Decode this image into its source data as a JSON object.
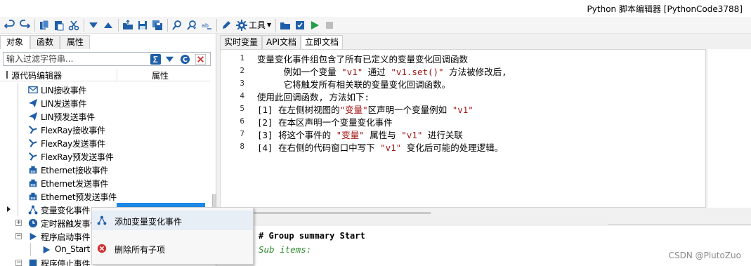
{
  "window": {
    "title": "Python 脚本编辑器 [PythonCode3788]"
  },
  "toolbar": {
    "tools_label": "工具"
  },
  "left_panel": {
    "tabs": [
      "对象",
      "函数",
      "属性"
    ],
    "filter_placeholder": "输入过滤字符串...",
    "tree_header": {
      "col1": "源代码编辑器",
      "col2": "属性"
    },
    "tree_items": [
      {
        "label": "LIN接收事件",
        "icon": "envelope-icon"
      },
      {
        "label": "LIN发送事件",
        "icon": "send-icon"
      },
      {
        "label": "LIN预发送事件",
        "icon": "send-icon"
      },
      {
        "label": "FlexRay接收事件",
        "icon": "flexray-icon"
      },
      {
        "label": "FlexRay发送事件",
        "icon": "flexray-icon"
      },
      {
        "label": "FlexRay预发送事件",
        "icon": "flexray-icon"
      },
      {
        "label": "Ethernet接收事件",
        "icon": "ethernet-icon"
      },
      {
        "label": "Ethernet发送事件",
        "icon": "ethernet-icon"
      },
      {
        "label": "Ethernet预发送事件",
        "icon": "ethernet-icon"
      },
      {
        "label": "变量变化事件",
        "icon": "variable-tree-icon"
      },
      {
        "label": "定时器触发事件",
        "icon": "clock-icon"
      },
      {
        "label": "程序启动事件",
        "icon": "play-icon"
      },
      {
        "label": "On_Start",
        "icon": "play-icon"
      },
      {
        "label": "程序停止事件",
        "icon": "stop-icon"
      }
    ]
  },
  "right_panel": {
    "tabs": [
      "实时变量",
      "API文档",
      "立即文档"
    ],
    "active_tab": "立即文档",
    "code_lines": [
      {
        "n": "1",
        "parts": [
          {
            "t": "变量变化事件组包含了所有已定义的变量变化回调函数"
          }
        ]
      },
      {
        "n": "2",
        "parts": [
          {
            "t": "     例如一个变量 "
          },
          {
            "t": "\"v1\"",
            "s": 1
          },
          {
            "t": " 通过 "
          },
          {
            "t": "\"v1.set()\"",
            "s": 1
          },
          {
            "t": " 方法被修改后,"
          }
        ]
      },
      {
        "n": "3",
        "parts": [
          {
            "t": "     它将触发所有相关联的变量变化回调函数。"
          }
        ]
      },
      {
        "n": "4",
        "parts": [
          {
            "t": "使用此回调函数, 方法如下:"
          }
        ]
      },
      {
        "n": "5",
        "parts": [
          {
            "t": "[1] 在左侧树视图的"
          },
          {
            "t": "\"变量\"",
            "s": 1
          },
          {
            "t": "区声明一个变量例如 "
          },
          {
            "t": "\"v1\"",
            "s": 1
          }
        ]
      },
      {
        "n": "6",
        "parts": [
          {
            "t": "[2] 在本区声明一个变量变化事件"
          }
        ]
      },
      {
        "n": "7",
        "parts": [
          {
            "t": "[3] 将这个事件的 "
          },
          {
            "t": "\"变量\"",
            "s": 1
          },
          {
            "t": " 属性与 "
          },
          {
            "t": "\"v1\"",
            "s": 1
          },
          {
            "t": " 进行关联"
          }
        ]
      },
      {
        "n": "8",
        "parts": [
          {
            "t": "[4] 在右侧的代码窗口中写下 "
          },
          {
            "t": "\"v1\"",
            "s": 1
          },
          {
            "t": " 变化后可能的处理逻辑。"
          }
        ]
      }
    ],
    "output_line1": "# Group summary Start",
    "output_line2": "Sub items:"
  },
  "context_menu": {
    "items": [
      {
        "label": "添加变量变化事件",
        "icon": "add-variable-event-icon"
      },
      {
        "label": "删除所有子项",
        "icon": "delete-icon"
      }
    ]
  },
  "watermark": "CSDN @PlutoZuo",
  "colors": {
    "accent": "#1e88e5",
    "string": "#a31515",
    "comment_green": "#2e8b2e",
    "icon_blue": "#1f5fa8"
  }
}
